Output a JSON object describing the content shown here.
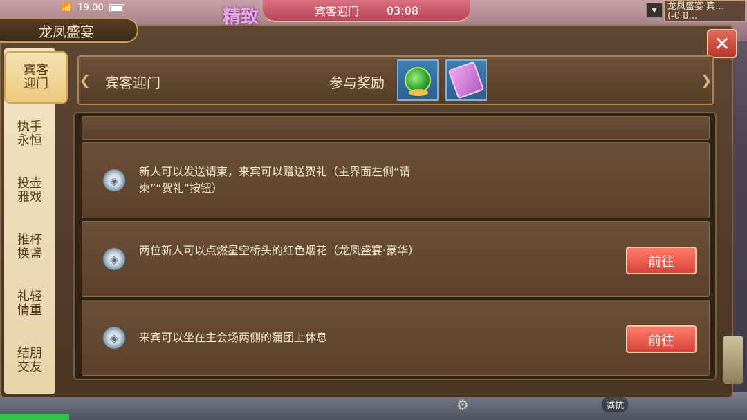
{
  "status_bar": {
    "time": "19:00"
  },
  "top_banner": {
    "event_name": "宾客迎门",
    "timer": "03:08"
  },
  "ornament_text": "精致",
  "top_right_tag": {
    "line1": "龙凤盛宴·宾…",
    "line2": "(-0 8…"
  },
  "window": {
    "title": "龙凤盛宴",
    "close_symbol": "✕"
  },
  "sidebar": {
    "tabs": [
      {
        "label": "宾客迎门",
        "active": true
      },
      {
        "label": "执手永恒",
        "active": false
      },
      {
        "label": "投壶雅戏",
        "active": false
      },
      {
        "label": "推杯换盏",
        "active": false
      },
      {
        "label": "礼轻情重",
        "active": false
      },
      {
        "label": "结朋交友",
        "active": false
      }
    ]
  },
  "header": {
    "title": "宾客迎门",
    "reward_label": "参与奖励",
    "rewards": [
      {
        "icon": "green-gem-icon"
      },
      {
        "icon": "purple-scroll-icon"
      }
    ]
  },
  "tasks": [
    {
      "text": "新人可以发送请柬，来宾可以赠送贺礼（主界面左侧“请柬”“贺礼”按钮）",
      "button": ""
    },
    {
      "text": "两位新人可以点燃星空桥头的红色烟花（龙凤盛宴·豪华）",
      "button": "前往"
    },
    {
      "text": "来宾可以坐在主会场两侧的蒲团上休息",
      "button": "前往"
    }
  ],
  "bottom": {
    "resist_label": "减抗"
  },
  "colors": {
    "accent_gold": "#d4a44d",
    "button_red": "#d8453a",
    "panel_brown": "#5b412c"
  }
}
